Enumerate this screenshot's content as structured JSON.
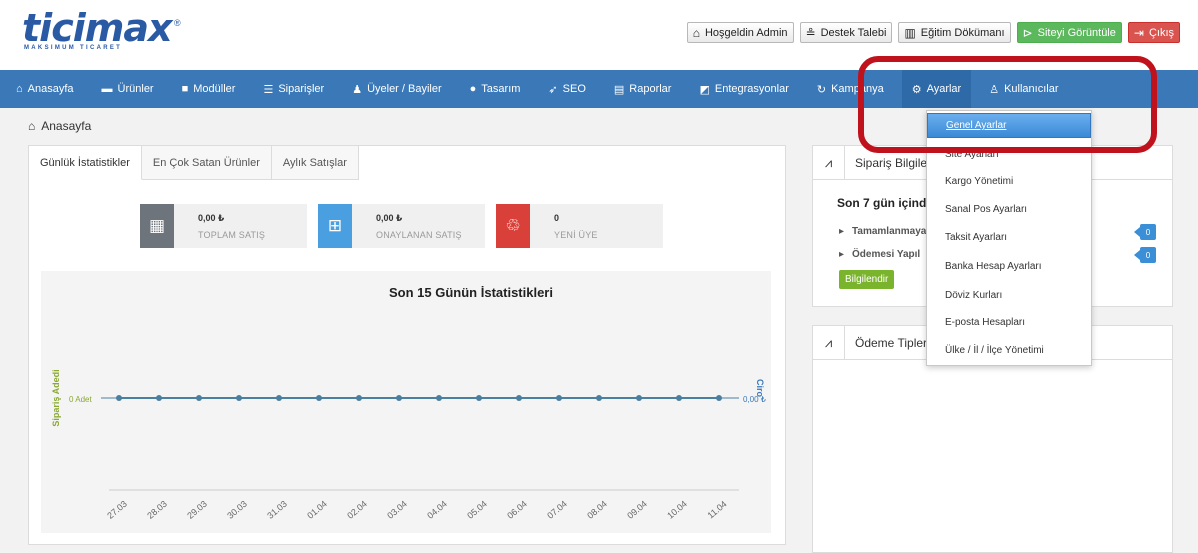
{
  "header": {
    "logo_text": "ticimax",
    "logo_reg": "®",
    "logo_sub": "MAKSIMUM TICARET",
    "buttons": [
      {
        "label": "Hoşgeldin Admin",
        "icon": "home-icon"
      },
      {
        "label": "Destek Talebi",
        "icon": "support-icon"
      },
      {
        "label": "Eğitim Dökümanı",
        "icon": "books-icon"
      },
      {
        "label": "Siteyi Görüntüle",
        "icon": "play-circle-icon"
      },
      {
        "label": "Çıkış",
        "icon": "logout-icon"
      }
    ]
  },
  "nav": {
    "items": [
      {
        "label": "Anasayfa",
        "icon": "home-icon"
      },
      {
        "label": "Ürünler",
        "icon": "folder-icon"
      },
      {
        "label": "Modüller",
        "icon": "box-icon"
      },
      {
        "label": "Siparişler",
        "icon": "list-icon"
      },
      {
        "label": "Üyeler / Bayiler",
        "icon": "users-icon"
      },
      {
        "label": "Tasarım",
        "icon": "palette-icon"
      },
      {
        "label": "SEO",
        "icon": "rocket-icon"
      },
      {
        "label": "Raporlar",
        "icon": "report-icon"
      },
      {
        "label": "Entegrasyonlar",
        "icon": "integration-icon"
      },
      {
        "label": "Kampanya",
        "icon": "refresh-icon"
      },
      {
        "label": "Ayarlar",
        "icon": "wrench-icon"
      },
      {
        "label": "Kullanıcılar",
        "icon": "user-icon"
      }
    ]
  },
  "breadcrumb": {
    "label": "Anasayfa"
  },
  "tabs": [
    "Günlük İstatistikler",
    "En Çok Satan Ürünler",
    "Aylık Satışlar"
  ],
  "stats": [
    {
      "value": "0,00 ₺",
      "label": "TOPLAM SATIŞ",
      "color": "#6d747c",
      "icon": "calculator-icon"
    },
    {
      "value": "0,00 ₺",
      "label": "ONAYLANAN SATIŞ",
      "color": "#4a9fe0",
      "icon": "calculator-grid-icon"
    },
    {
      "value": "0",
      "label": "YENİ ÜYE",
      "color": "#d9403a",
      "icon": "add-user-icon"
    }
  ],
  "chart_data": {
    "type": "line",
    "title": "Son 15 Günün İstatistikleri",
    "categories": [
      "27.03",
      "28.03",
      "29.03",
      "30.03",
      "31.03",
      "01.04",
      "02.04",
      "03.04",
      "04.04",
      "05.04",
      "06.04",
      "07.04",
      "08.04",
      "09.04",
      "10.04",
      "11.04"
    ],
    "series": [
      {
        "name": "Sipariş Adedi",
        "values": [
          0,
          0,
          0,
          0,
          0,
          0,
          0,
          0,
          0,
          0,
          0,
          0,
          0,
          0,
          0,
          0
        ]
      },
      {
        "name": "Ciro",
        "values": [
          0,
          0,
          0,
          0,
          0,
          0,
          0,
          0,
          0,
          0,
          0,
          0,
          0,
          0,
          0,
          0
        ]
      }
    ],
    "ylabel_left": "Sipariş Adedi",
    "ylabel_right": "Ciro",
    "left_tick": "0 Adet",
    "right_tick": "0,00 ₺",
    "colors": {
      "left_axis": "#8aa832",
      "right_axis": "#3a78b8",
      "line": "#4a7fa0"
    }
  },
  "siparis_panel": {
    "title": "Sipariş Bilgile",
    "subtitle": "Son 7 gün içind",
    "lines": [
      {
        "label": "Tamamlanmaya",
        "badge": "0"
      },
      {
        "label": "Ödemesi Yapıl",
        "badge": "0"
      }
    ],
    "button": "Bilgilendir"
  },
  "odeme_panel": {
    "title": "Ödeme Tipler"
  },
  "dropdown": {
    "items": [
      "Genel Ayarlar",
      "Site Ayarları",
      "Kargo Yönetimi",
      "Sanal Pos Ayarları",
      "Taksit Ayarları",
      "Banka Hesap Ayarları",
      "Döviz Kurları",
      "E-posta Hesapları",
      "Ülke / İl / İlçe Yönetimi"
    ],
    "selected": "Genel Ayarlar"
  }
}
